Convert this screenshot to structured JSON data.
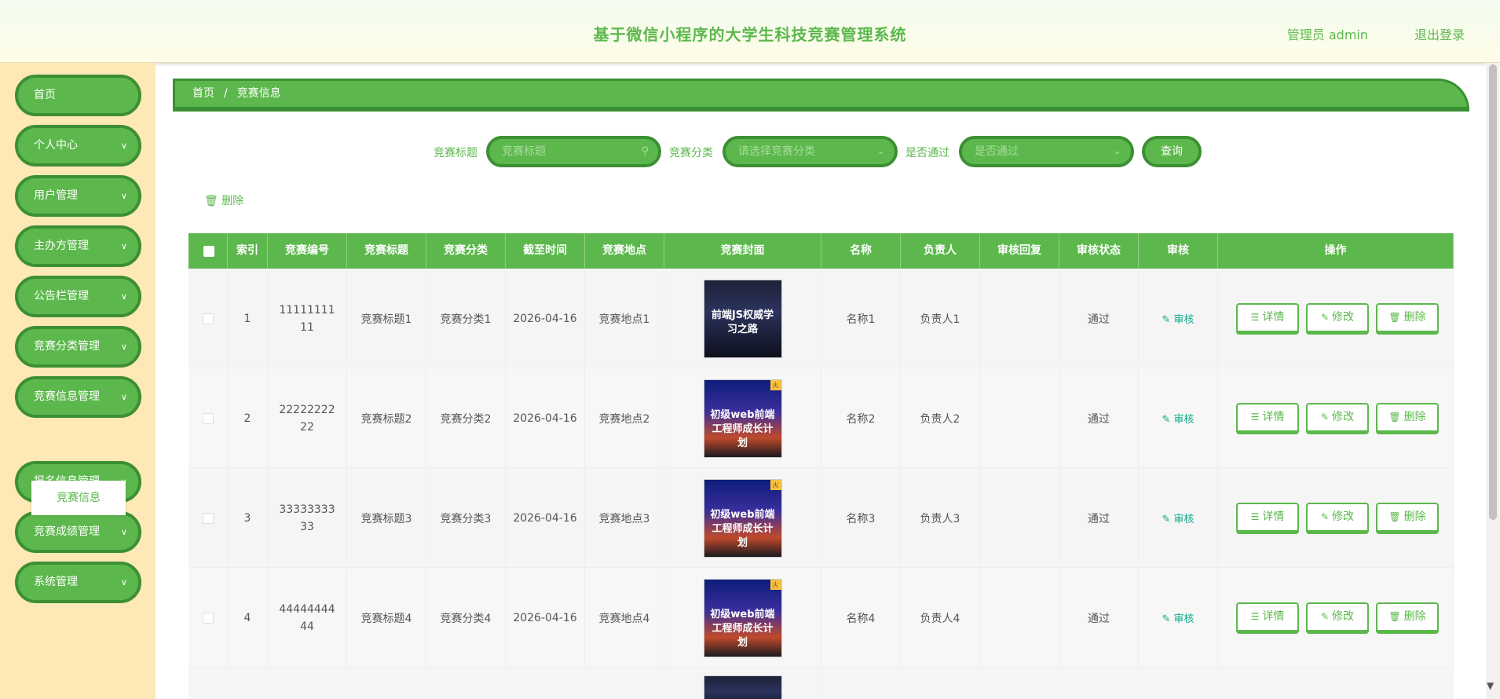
{
  "header": {
    "title": "基于微信小程序的大学生科技竞赛管理系统",
    "user": "管理员 admin",
    "logout": "退出登录"
  },
  "sidebar": {
    "items": [
      {
        "label": "首页",
        "has_chevron": false
      },
      {
        "label": "个人中心",
        "has_chevron": true
      },
      {
        "label": "用户管理",
        "has_chevron": true
      },
      {
        "label": "主办方管理",
        "has_chevron": true
      },
      {
        "label": "公告栏管理",
        "has_chevron": true
      },
      {
        "label": "竞赛分类管理",
        "has_chevron": true
      },
      {
        "label": "竞赛信息管理",
        "has_chevron": true
      },
      {
        "label": "报名信息管理",
        "has_chevron": true
      },
      {
        "label": "竞赛成绩管理",
        "has_chevron": true
      },
      {
        "label": "系统管理",
        "has_chevron": true
      }
    ],
    "submenu": "竞赛信息"
  },
  "breadcrumb": {
    "home": "首页",
    "sep": "/",
    "current": "竞赛信息"
  },
  "search": {
    "title_label": "竞赛标题",
    "title_placeholder": "竞赛标题",
    "category_label": "竞赛分类",
    "category_placeholder": "请选择竞赛分类",
    "passed_label": "是否通过",
    "passed_placeholder": "是否通过",
    "query_button": "查询"
  },
  "toolbar": {
    "delete": "删除"
  },
  "table": {
    "headers": [
      "索引",
      "竞赛编号",
      "竞赛标题",
      "竞赛分类",
      "截至时间",
      "竞赛地点",
      "竞赛封面",
      "名称",
      "负责人",
      "审核回复",
      "审核状态",
      "审核",
      "操作"
    ],
    "audit_link": "审核",
    "actions": {
      "detail": "详情",
      "edit": "修改",
      "delete": "删除"
    },
    "rows": [
      {
        "index": "1",
        "code": "1111111111",
        "title": "竞赛标题1",
        "category": "竞赛分类1",
        "deadline": "2026-04-16",
        "location": "竞赛地点1",
        "cover_text": "前端JS权威学习之路",
        "cover_tag": "",
        "name": "名称1",
        "owner": "负责人1",
        "reply": "",
        "status": "通过"
      },
      {
        "index": "2",
        "code": "2222222222",
        "title": "竞赛标题2",
        "category": "竞赛分类2",
        "deadline": "2026-04-16",
        "location": "竞赛地点2",
        "cover_text": "初级web前端工程师成长计划",
        "cover_tag": "火",
        "name": "名称2",
        "owner": "负责人2",
        "reply": "",
        "status": "通过"
      },
      {
        "index": "3",
        "code": "3333333333",
        "title": "竞赛标题3",
        "category": "竞赛分类3",
        "deadline": "2026-04-16",
        "location": "竞赛地点3",
        "cover_text": "初级web前端工程师成长计划",
        "cover_tag": "火",
        "name": "名称3",
        "owner": "负责人3",
        "reply": "",
        "status": "通过"
      },
      {
        "index": "4",
        "code": "4444444444",
        "title": "竞赛标题4",
        "category": "竞赛分类4",
        "deadline": "2026-04-16",
        "location": "竞赛地点4",
        "cover_text": "初级web前端工程师成长计划",
        "cover_tag": "火",
        "name": "名称4",
        "owner": "负责人4",
        "reply": "",
        "status": "通过"
      }
    ]
  },
  "colors": {
    "primary": "#5cb84c",
    "primary_dark": "#3c8f33",
    "sidebar_bg": "#fde8b6",
    "audit_link": "#13a88c"
  }
}
